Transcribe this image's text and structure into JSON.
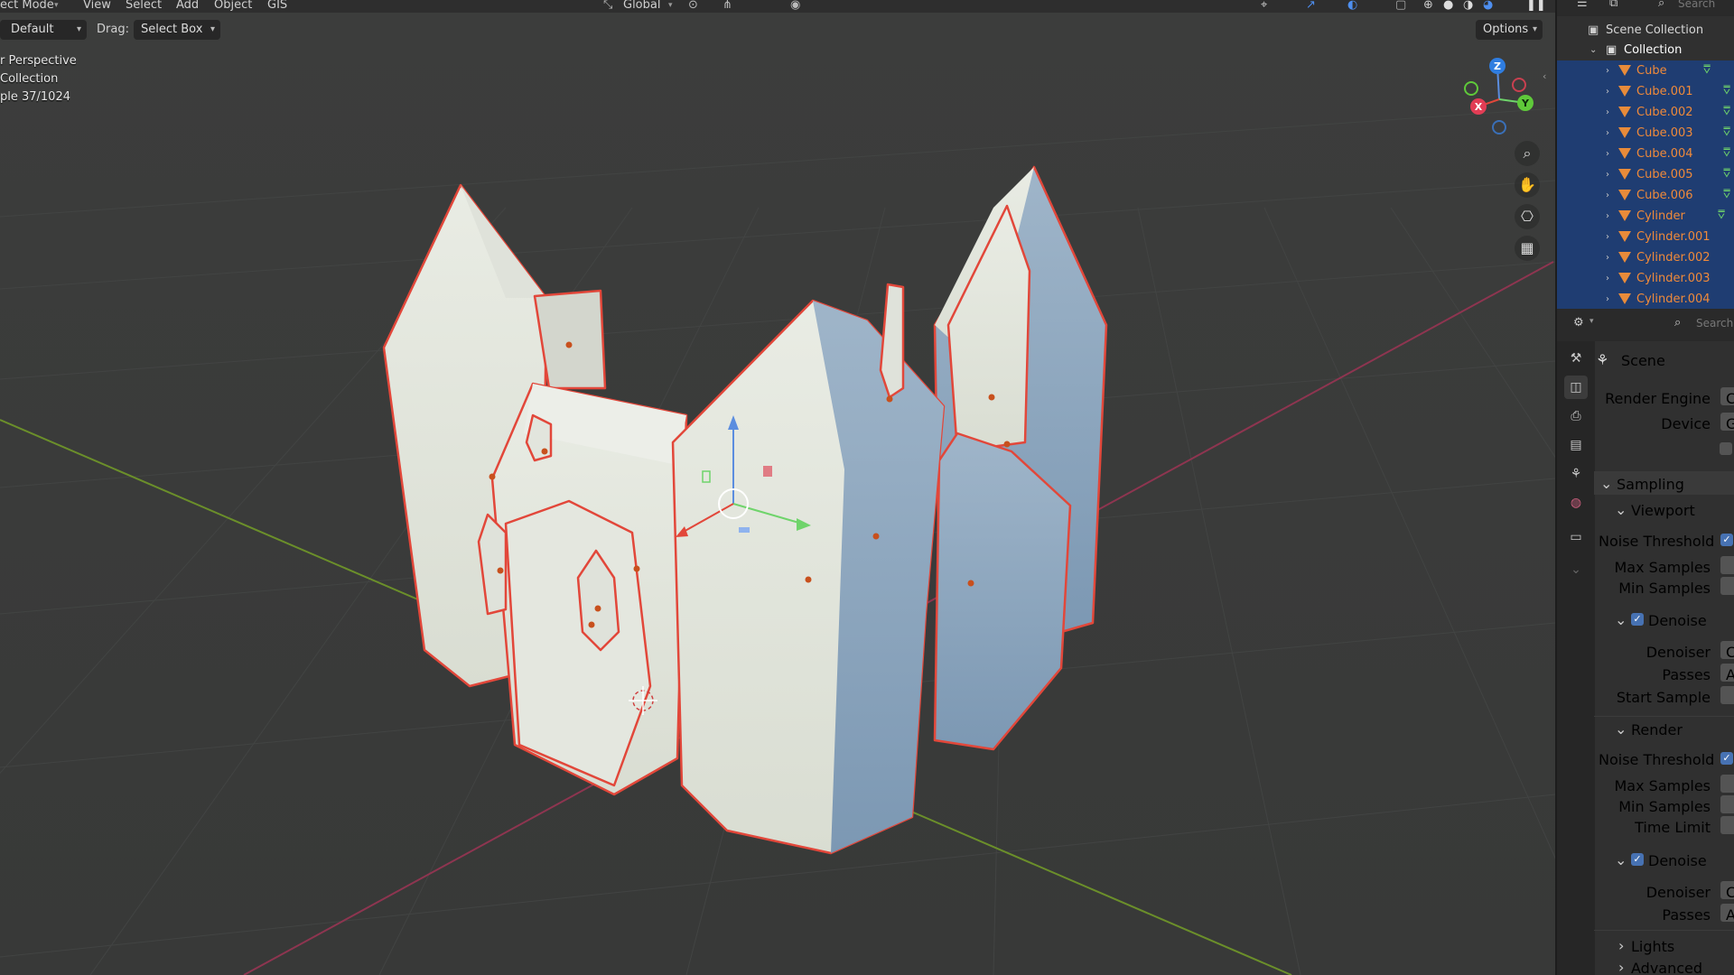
{
  "topbar": {
    "mode": "ect Mode",
    "menus": [
      "View",
      "Select",
      "Add",
      "Object",
      "GIS"
    ],
    "transform_orientation": "Global",
    "search_placeholder": "Search"
  },
  "header2": {
    "orientation_value": "Default",
    "drag_label": "Drag:",
    "drag_value": "Select Box",
    "options_label": "Options"
  },
  "viewport_info": {
    "line1": "r Perspective",
    "line2": "Collection",
    "line3": "ple 37/1024"
  },
  "gizmo": {
    "z": "Z",
    "y": "Y",
    "x": "X"
  },
  "outliner": {
    "root": "Scene Collection",
    "collection": "Collection",
    "objects": [
      "Cube",
      "Cube.001",
      "Cube.002",
      "Cube.003",
      "Cube.004",
      "Cube.005",
      "Cube.006",
      "Cylinder",
      "Cylinder.001",
      "Cylinder.002",
      "Cylinder.003",
      "Cylinder.004"
    ]
  },
  "properties": {
    "search_placeholder": "Search",
    "context": "Scene",
    "render_engine_label": "Render Engine",
    "render_engine_value": "C",
    "device_label": "Device",
    "device_value": "G",
    "sampling": "Sampling",
    "viewport": "Viewport",
    "vp_noise_threshold": "Noise Threshold",
    "vp_max_samples": "Max Samples",
    "vp_min_samples": "Min Samples",
    "vp_denoise": "Denoise",
    "vp_denoiser": "Denoiser",
    "vp_denoiser_value": "C",
    "vp_passes": "Passes",
    "vp_passes_value": "A",
    "vp_start_sample": "Start Sample",
    "render": "Render",
    "r_noise_threshold": "Noise Threshold",
    "r_max_samples": "Max Samples",
    "r_min_samples": "Min Samples",
    "r_time_limit": "Time Limit",
    "r_denoise": "Denoise",
    "r_denoiser": "Denoiser",
    "r_denoiser_value": "C",
    "r_passes": "Passes",
    "r_passes_value": "A",
    "lights": "Lights",
    "advanced": "Advanced"
  },
  "colors": {
    "selection_outline": "#e2473a",
    "outliner_selected_bg": "#1f3d72",
    "object_name_selected": "#f08a3a",
    "checkbox": "#4772b3"
  }
}
